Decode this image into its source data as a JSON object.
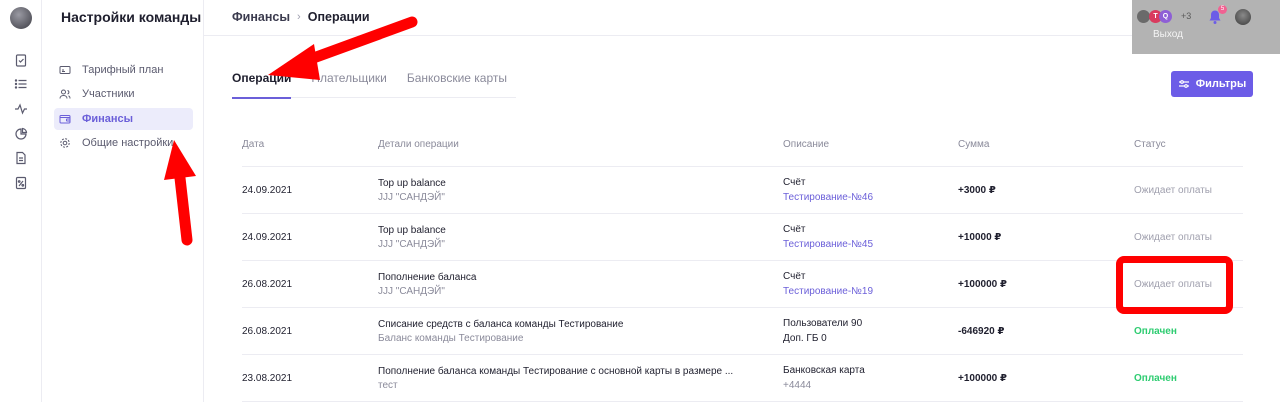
{
  "sidebar": {
    "title": "Настройки команды",
    "items": [
      {
        "label": "Тарифный план",
        "icon": "card-icon"
      },
      {
        "label": "Участники",
        "icon": "users-icon"
      },
      {
        "label": "Финансы",
        "icon": "wallet-icon",
        "active": true
      },
      {
        "label": "Общие настройки",
        "icon": "gear-icon"
      }
    ]
  },
  "rail_icons": [
    "clipboard-check-icon",
    "list-icon",
    "activity-icon",
    "pie-chart-icon",
    "document-icon",
    "percent-document-icon"
  ],
  "breadcrumb": {
    "parent": "Финансы",
    "separator": "›",
    "current": "Операции"
  },
  "popup": {
    "avatars": [
      "T",
      "Q"
    ],
    "more": "+3",
    "notifications": "5",
    "exit": "Выход"
  },
  "tabs": [
    {
      "label": "Операции",
      "active": true
    },
    {
      "label": "Плательщики"
    },
    {
      "label": "Банковские карты"
    }
  ],
  "filter_button": "Фильтры",
  "table": {
    "headers": {
      "date": "Дата",
      "details": "Детали операции",
      "description": "Описание",
      "amount": "Сумма",
      "status": "Статус"
    },
    "rows": [
      {
        "date": "24.09.2021",
        "details": "Top up balance",
        "details_sub": "JJJ \"САНДЭЙ\"",
        "desc": "Счёт",
        "desc_sub": "Тестирование-№46",
        "amount": "+3000 ₽",
        "status": "Ожидает оплаты",
        "paid": false
      },
      {
        "date": "24.09.2021",
        "details": "Top up balance",
        "details_sub": "JJJ \"САНДЭЙ\"",
        "desc": "Счёт",
        "desc_sub": "Тестирование-№45",
        "amount": "+10000 ₽",
        "status": "Ожидает оплаты",
        "paid": false
      },
      {
        "date": "26.08.2021",
        "details": "Пополнение баланса",
        "details_sub": "JJJ \"САНДЭЙ\"",
        "desc": "Счёт",
        "desc_sub": "Тестирование-№19",
        "amount": "+100000 ₽",
        "status": "Ожидает оплаты",
        "paid": false
      },
      {
        "date": "26.08.2021",
        "details": "Списание средств с баланса команды Тестирование",
        "details_sub": "Баланс команды Тестирование",
        "desc": "Пользователи 90",
        "desc_sub": "Доп. ГБ 0",
        "amount": "-646920 ₽",
        "status": "Оплачен",
        "paid": true
      },
      {
        "date": "23.08.2021",
        "details": "Пополнение баланса команды Тестирование с основной карты в размере ...",
        "details_sub": "тест",
        "desc": "Банковская карта",
        "desc_sub": "+4444",
        "amount": "+100000 ₽",
        "status": "Оплачен",
        "paid": true
      }
    ]
  },
  "colors": {
    "accent": "#6c5ce7",
    "paid": "#2ecc71",
    "annotation": "#ff0000"
  }
}
